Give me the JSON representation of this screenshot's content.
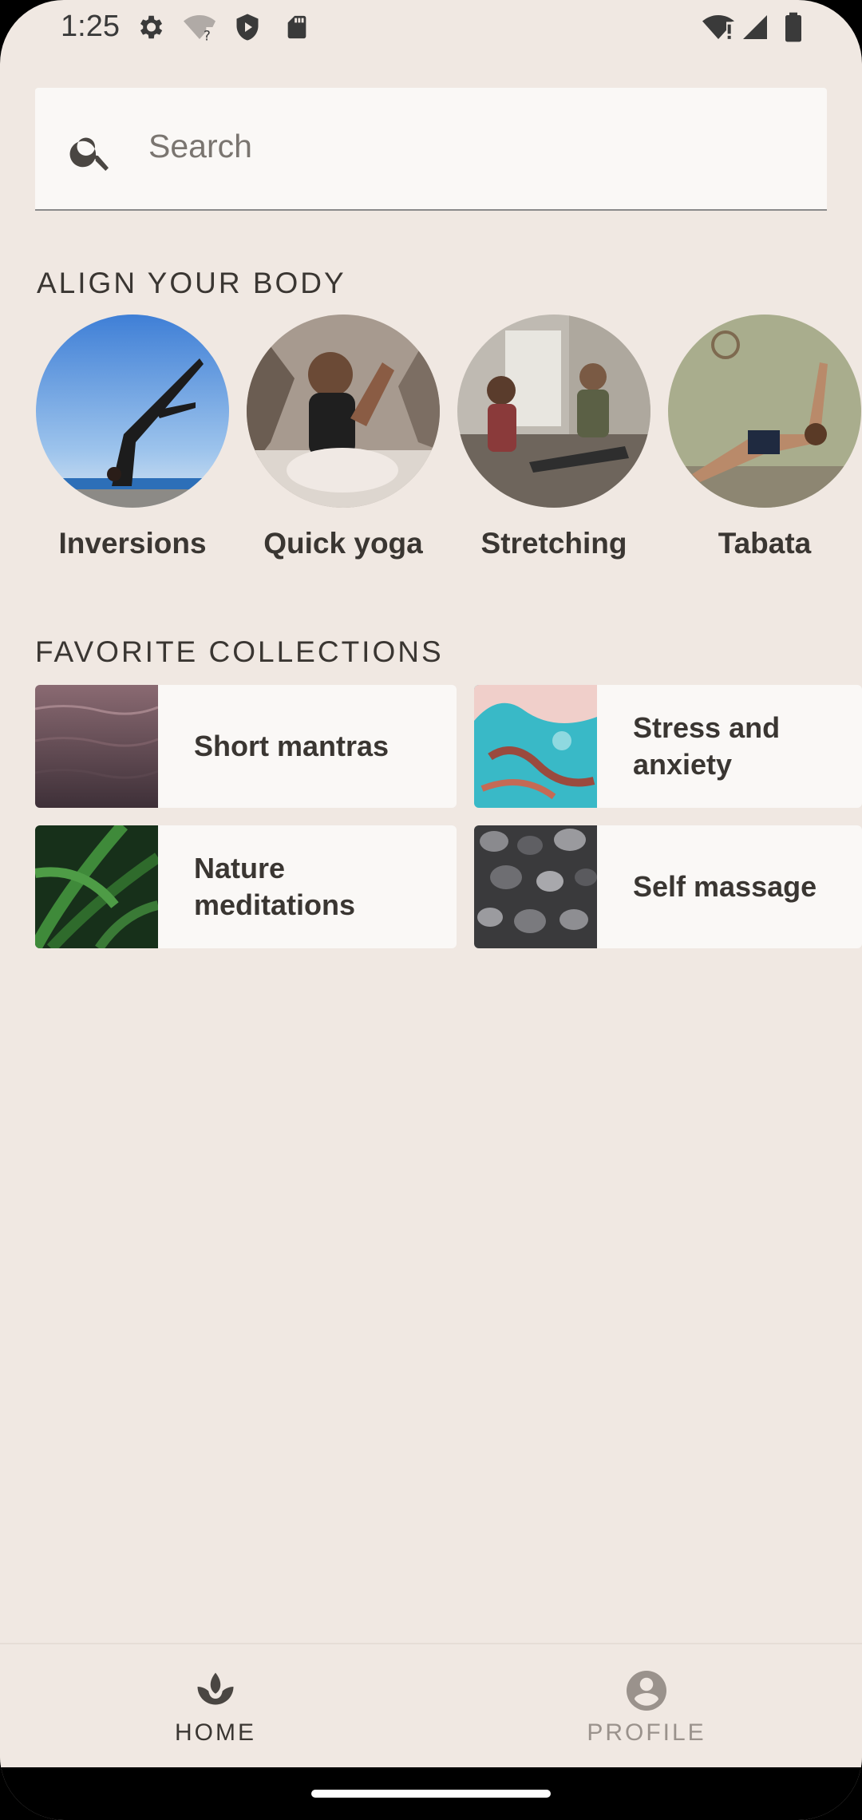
{
  "status_bar": {
    "time": "1:25",
    "icons_left": [
      "gear-icon",
      "wifi-question-icon",
      "shield-play-icon",
      "sd-card-icon"
    ],
    "icons_right": [
      "wifi-alert-icon",
      "cell-signal-icon",
      "battery-icon"
    ]
  },
  "search": {
    "placeholder": "Search",
    "icon": "search-icon"
  },
  "align_section": {
    "title": "ALIGN YOUR BODY",
    "items": [
      {
        "label": "Inversions"
      },
      {
        "label": "Quick yoga"
      },
      {
        "label": "Stretching"
      },
      {
        "label": "Tabata"
      }
    ]
  },
  "collections_section": {
    "title": "FAVORITE COLLECTIONS",
    "cards": [
      {
        "label": "Short mantras"
      },
      {
        "label": "Stress and anxiety"
      },
      {
        "label": "Nature meditations"
      },
      {
        "label": "Self massage"
      }
    ]
  },
  "bottom_nav": {
    "items": [
      {
        "label": "HOME",
        "icon": "lotus-icon",
        "active": true
      },
      {
        "label": "PROFILE",
        "icon": "account-circle-icon",
        "active": false
      }
    ]
  },
  "colors": {
    "background": "#f0e8e2",
    "surface": "#faf8f6",
    "text": "#3a3632",
    "nav_inactive": "#9a928c"
  }
}
